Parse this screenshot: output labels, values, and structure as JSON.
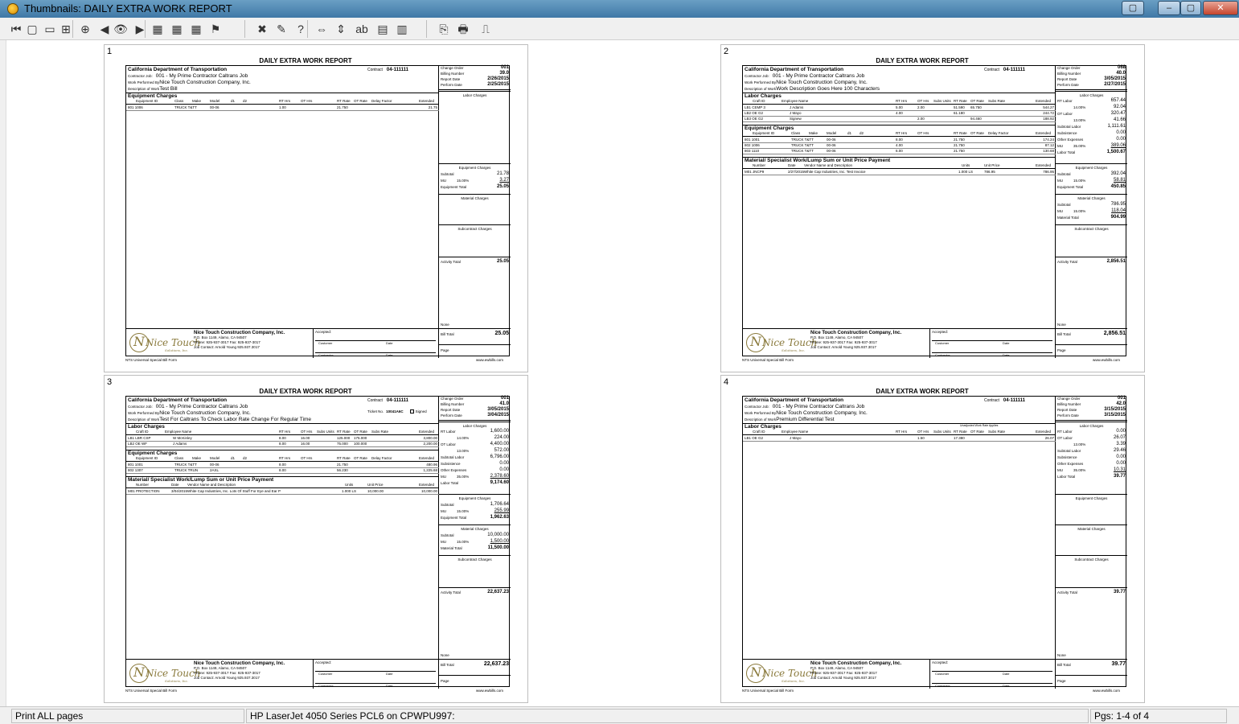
{
  "window": {
    "title": "Thumbnails: DAILY EXTRA WORK REPORT",
    "minimize": "–",
    "maximize": "▢",
    "close": "✕"
  },
  "toolbar": {
    "icons": [
      "first-page-icon",
      "single-page-icon",
      "two-page-icon",
      "multi-page-icon",
      "zoom-icon",
      "prev-icon",
      "view-icon",
      "next-icon",
      "grid-1-icon",
      "grid-2-icon",
      "grid-3-icon",
      "flag-icon",
      "close-icon",
      "edit-icon",
      "help-icon",
      "fit-width-icon",
      "fit-page-icon",
      "text-icon",
      "note-icon",
      "thumbnails-icon",
      "export-icon",
      "print-icon",
      "page-setup-icon"
    ],
    "glyphs": [
      "⏮",
      "▢",
      "▭",
      "⊞",
      "⊕",
      "◀",
      "👁",
      "▶",
      "▦",
      "▦",
      "▦",
      "⚑",
      "✖",
      "✎",
      "?",
      "⇔",
      "⇕",
      "ab",
      "▤",
      "▥",
      "⎘",
      "🖶",
      "⎍"
    ]
  },
  "common": {
    "report_title": "DAILY EXTRA WORK REPORT",
    "dept": "California Department of Transportation",
    "contract_label": "Contract",
    "contract_no": "04-111111",
    "contractor_label": "Contractor Job:",
    "contractor_job": "001 - My Prime Contractor Caltrans Job",
    "performed_label": "Work Performed By",
    "performed_by": "Nice Touch Construction Company, Inc.",
    "desc_label": "Description of Work",
    "h_change_order": "Change Order",
    "h_billing": "Billing Number",
    "h_report_date": "Report Date",
    "h_perform_date": "Perform Date",
    "co_name": "Nice Touch Construction Company, Inc.",
    "co_addr": "P.O. Box 1149, Alamo, CA 94507",
    "co_phone": "Phone: 925-937-3017  Fax: 925-937-3017",
    "co_contact": "Job Contact: Arnold Young 925.937.3017",
    "accepted": "Accepted:",
    "customer": "Customer",
    "date": "Date",
    "contractor": "Contractor",
    "bill_total": "Bill Total",
    "page_label": "Page",
    "form_name": "NTS Universal Special Bill Form",
    "site": "www.ewbills.com",
    "logo_word": "Nice Touch",
    "logo_sub": "Solutions, Inc.",
    "logo_mark": "N",
    "labor_charges": "Labor Charges",
    "equipment_charges": "Equipment Charges",
    "material_charges": "Material Charges",
    "subcontract_charges": "Subcontract Charges",
    "activity_total": "Activity Total",
    "none": "None",
    "material_sec": "Material/ Specialist Work/Lump Sum or Unit Price Payment",
    "lab_cols": [
      "Craft ID",
      "Employee Name",
      "RT Hrs",
      "OT Hrs",
      "Subs Units",
      "RT Rate",
      "OT Rate",
      "Subs Rate",
      "Extended"
    ],
    "eq_cols": [
      "Equipment ID",
      "Class",
      "Make",
      "Model",
      "d1",
      "d2",
      "RT Hrs",
      "OT Hrs",
      "RT Rate",
      "OT Rate",
      "Delay Factor",
      "Extended"
    ],
    "mat_cols": [
      "Number",
      "Date",
      "Vendor Name and Description",
      "Units",
      "Unit Price",
      "Extended"
    ],
    "subtotal": "Subtotal",
    "mu": "MU",
    "equip_total": "Equipment Total",
    "material_total": "Material Total",
    "rt_labor": "RT Labor",
    "ot_labor": "OT Labor",
    "subtotal_labor": "Subtotal Labor",
    "subsistence": "Subsistence",
    "other_exp": "Other Expenses",
    "labor_total": "Labor Total"
  },
  "pages": [
    {
      "num": "1",
      "change_order": "001",
      "billing": "39.0",
      "report_date": "2/26/2015",
      "perform_date": "2/25/2015",
      "desc": "Test Bill",
      "equipment_rows": [
        [
          "801 1006",
          "TRUCK T&TT",
          "00-06",
          "1.00",
          "21.750",
          "21.75"
        ]
      ],
      "eq_subtotal": "21.78",
      "eq_mu_pct": "15.00%",
      "eq_mu": "3.27",
      "eq_total": "25.05",
      "activity_total": "25.05",
      "bill_total": "25.05"
    },
    {
      "num": "2",
      "change_order": "068",
      "billing": "40.0",
      "report_date": "3/05/2015",
      "perform_date": "2/27/2015",
      "desc": "Work Description Goes Here 100 Characters",
      "labor_rows": [
        [
          "LB1 CEMP 3",
          "J Adams",
          "5.00",
          "2.00",
          "51.590",
          "65.750",
          "544.27"
        ],
        [
          "LB2 OE G2",
          "J Mayo",
          "4.00",
          "",
          "61.180",
          "",
          "244.72"
        ],
        [
          "LB3 OE G2",
          "Signew",
          "",
          "2.00",
          "",
          "94.460",
          "188.92"
        ]
      ],
      "rt_labor": "657.44",
      "lab_p1": "14.00%",
      "lab_v1": "92.04",
      "ot_labor": "320.47",
      "lab_p2": "13.00%",
      "lab_v2": "41.66",
      "subtotal_labor": "1,111.61",
      "subsistence": "0.00",
      "other_exp": "0.00",
      "lab_mu_pct": "35.00%",
      "lab_mu": "389.06",
      "labor_total": "1,500.67",
      "equipment_rows": [
        [
          "801 1001",
          "TRUCK T&TT",
          "00-06",
          "8.00",
          "21.750",
          "174.24"
        ],
        [
          "802 1006",
          "TRUCK T&TT",
          "00-06",
          "4.00",
          "21.750",
          "87.12"
        ],
        [
          "803 1110",
          "TRUCK T&TT",
          "00-06",
          "6.00",
          "21.750",
          "130.68"
        ]
      ],
      "eq_subtotal": "392.04",
      "eq_mu_pct": "15.00%",
      "eq_mu": "58.81",
      "eq_total": "450.85",
      "material_rows": [
        [
          "M01 JNCP9",
          "2/27/2015",
          "White Cap Industries, Inc. Test Invoice",
          "1.000 LS",
          "786.95",
          "786.95"
        ]
      ],
      "mat_subtotal": "786.95",
      "mat_mu_pct": "15.00%",
      "mat_mu": "118.04",
      "mat_total": "904.99",
      "activity_total": "2,856.51",
      "bill_total": "2,856.51"
    },
    {
      "num": "3",
      "change_order": "001",
      "billing": "41.0",
      "report_date": "3/05/2015",
      "perform_date": "3/04/2015",
      "desc": "Test For Caltrans To Check Labor Rate Change For Regular Time",
      "ticket_label": "Ticket No.",
      "ticket_no": "10041A6C",
      "signed": "Signed",
      "labor_rows": [
        [
          "LB1 LBR CSP",
          "W McKinley",
          "8.00",
          "16.00",
          "125.000",
          "175.000",
          "3,800.00"
        ],
        [
          "LB2 OE WF",
          "J Adams",
          "8.00",
          "16.00",
          "75.000",
          "100.000",
          "2,200.00"
        ]
      ],
      "rt_labor": "1,600.00",
      "lab_p1": "14.00%",
      "lab_v1": "224.00",
      "ot_labor": "4,400.00",
      "lab_p2": "13.00%",
      "lab_v2": "572.00",
      "subtotal_labor": "6,796.00",
      "subsistence": "0.00",
      "other_exp": "0.00",
      "lab_mu_pct": "35.00%",
      "lab_mu": "2,378.60",
      "labor_total": "9,174.60",
      "equipment_rows": [
        [
          "801 1001",
          "TRUCK T&TT",
          "00-06",
          "8.00",
          "21.750",
          "480.96"
        ],
        [
          "802 1307",
          "TRUCK TRUN",
          "2AXL",
          "8.00",
          "56.230",
          "1,225.68"
        ]
      ],
      "eq_subtotal": "1,706.64",
      "eq_mu_pct": "15.00%",
      "eq_mu": "255.99",
      "eq_total": "1,962.63",
      "material_rows": [
        [
          "M01 PROTECTION",
          "3/04/2015",
          "White Cap Industries, Inc. Lots Of Stuff For Eye and Ear P",
          "1.000 LS",
          "10,000.00",
          "10,000.00"
        ]
      ],
      "mat_subtotal": "10,000.00",
      "mat_mu_pct": "15.00%",
      "mat_mu": "1,500.00",
      "mat_total": "11,500.00",
      "activity_total": "22,637.23",
      "bill_total": "22,637.23"
    },
    {
      "num": "4",
      "change_order": "001",
      "billing": "42.0",
      "report_date": "3/15/2015",
      "perform_date": "3/15/2015",
      "desc": "Premium Differential Test",
      "labor_note": "Unadjusted Work Rate Applies",
      "labor_rows": [
        [
          "LB1 OE G2",
          "J Mayo",
          "",
          "1.50",
          "",
          "17.380",
          "",
          "26.07"
        ]
      ],
      "rt_labor": "0.00",
      "ot_labor": "26.07",
      "lab_p2": "13.00%",
      "lab_v2": "3.39",
      "subtotal_labor": "29.46",
      "subsistence": "0.00",
      "other_exp": "0.00",
      "lab_mu_pct": "35.00%",
      "lab_mu": "10.31",
      "labor_total": "39.77",
      "activity_total": "39.77",
      "bill_total": "39.77"
    }
  ],
  "status": {
    "print_mode": "Print ALL pages",
    "printer": "HP LaserJet 4050 Series PCL6 on CPWPU997:",
    "pages": "Pgs: 1-4 of 4"
  }
}
